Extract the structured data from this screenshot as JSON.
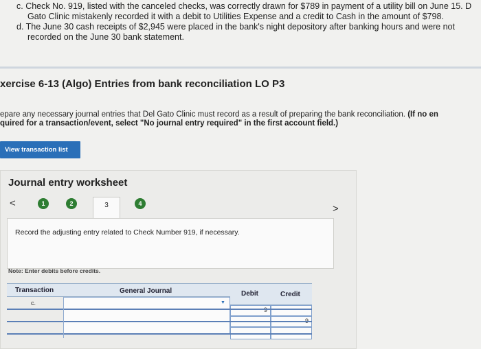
{
  "top_text": {
    "line_c1": "c. Check No. 919, listed with the canceled checks, was correctly drawn for $789 in payment of a utility bill on June 15. D",
    "line_c2": "Gato Clinic mistakenly recorded it with a debit to Utilities Expense and a credit to Cash in the amount of $798.",
    "line_d1": "d. The June 30 cash receipts of $2,945 were placed in the bank's night depository after banking hours and were not",
    "line_d2": "recorded on the June 30 bank statement."
  },
  "exercise": {
    "title": "xercise 6-13 (Algo) Entries from bank reconciliation LO P3",
    "instruction_normal": "epare any necessary journal entries that Del Gato Clinic must record as a result of preparing the bank reconciliation.",
    "instruction_bold_1": "(If no en",
    "instruction_bold_2": "quired for a transaction/event, select \"No journal entry required\" in the first account field.)"
  },
  "buttons": {
    "view_transaction_list": "View transaction list"
  },
  "worksheet": {
    "title": "Journal entry worksheet",
    "prev": "<",
    "next": ">",
    "steps": [
      "1",
      "2",
      "3",
      "4"
    ],
    "active_step": "3",
    "prompt": "Record the adjusting entry related to Check Number 919, if necessary.",
    "note": "Note: Enter debits before credits.",
    "columns": {
      "transaction": "Transaction",
      "general_journal": "General Journal",
      "debit": "Debit",
      "credit": "Credit"
    },
    "rows": [
      {
        "transaction": "c.",
        "account": "",
        "debit": "9",
        "credit": ""
      },
      {
        "transaction": "",
        "account": "",
        "debit": "",
        "credit": "9"
      },
      {
        "transaction": "",
        "account": "",
        "debit": "",
        "credit": ""
      }
    ]
  },
  "colors": {
    "accent_blue": "#2a6fb8",
    "step_green": "#2e7d32"
  }
}
